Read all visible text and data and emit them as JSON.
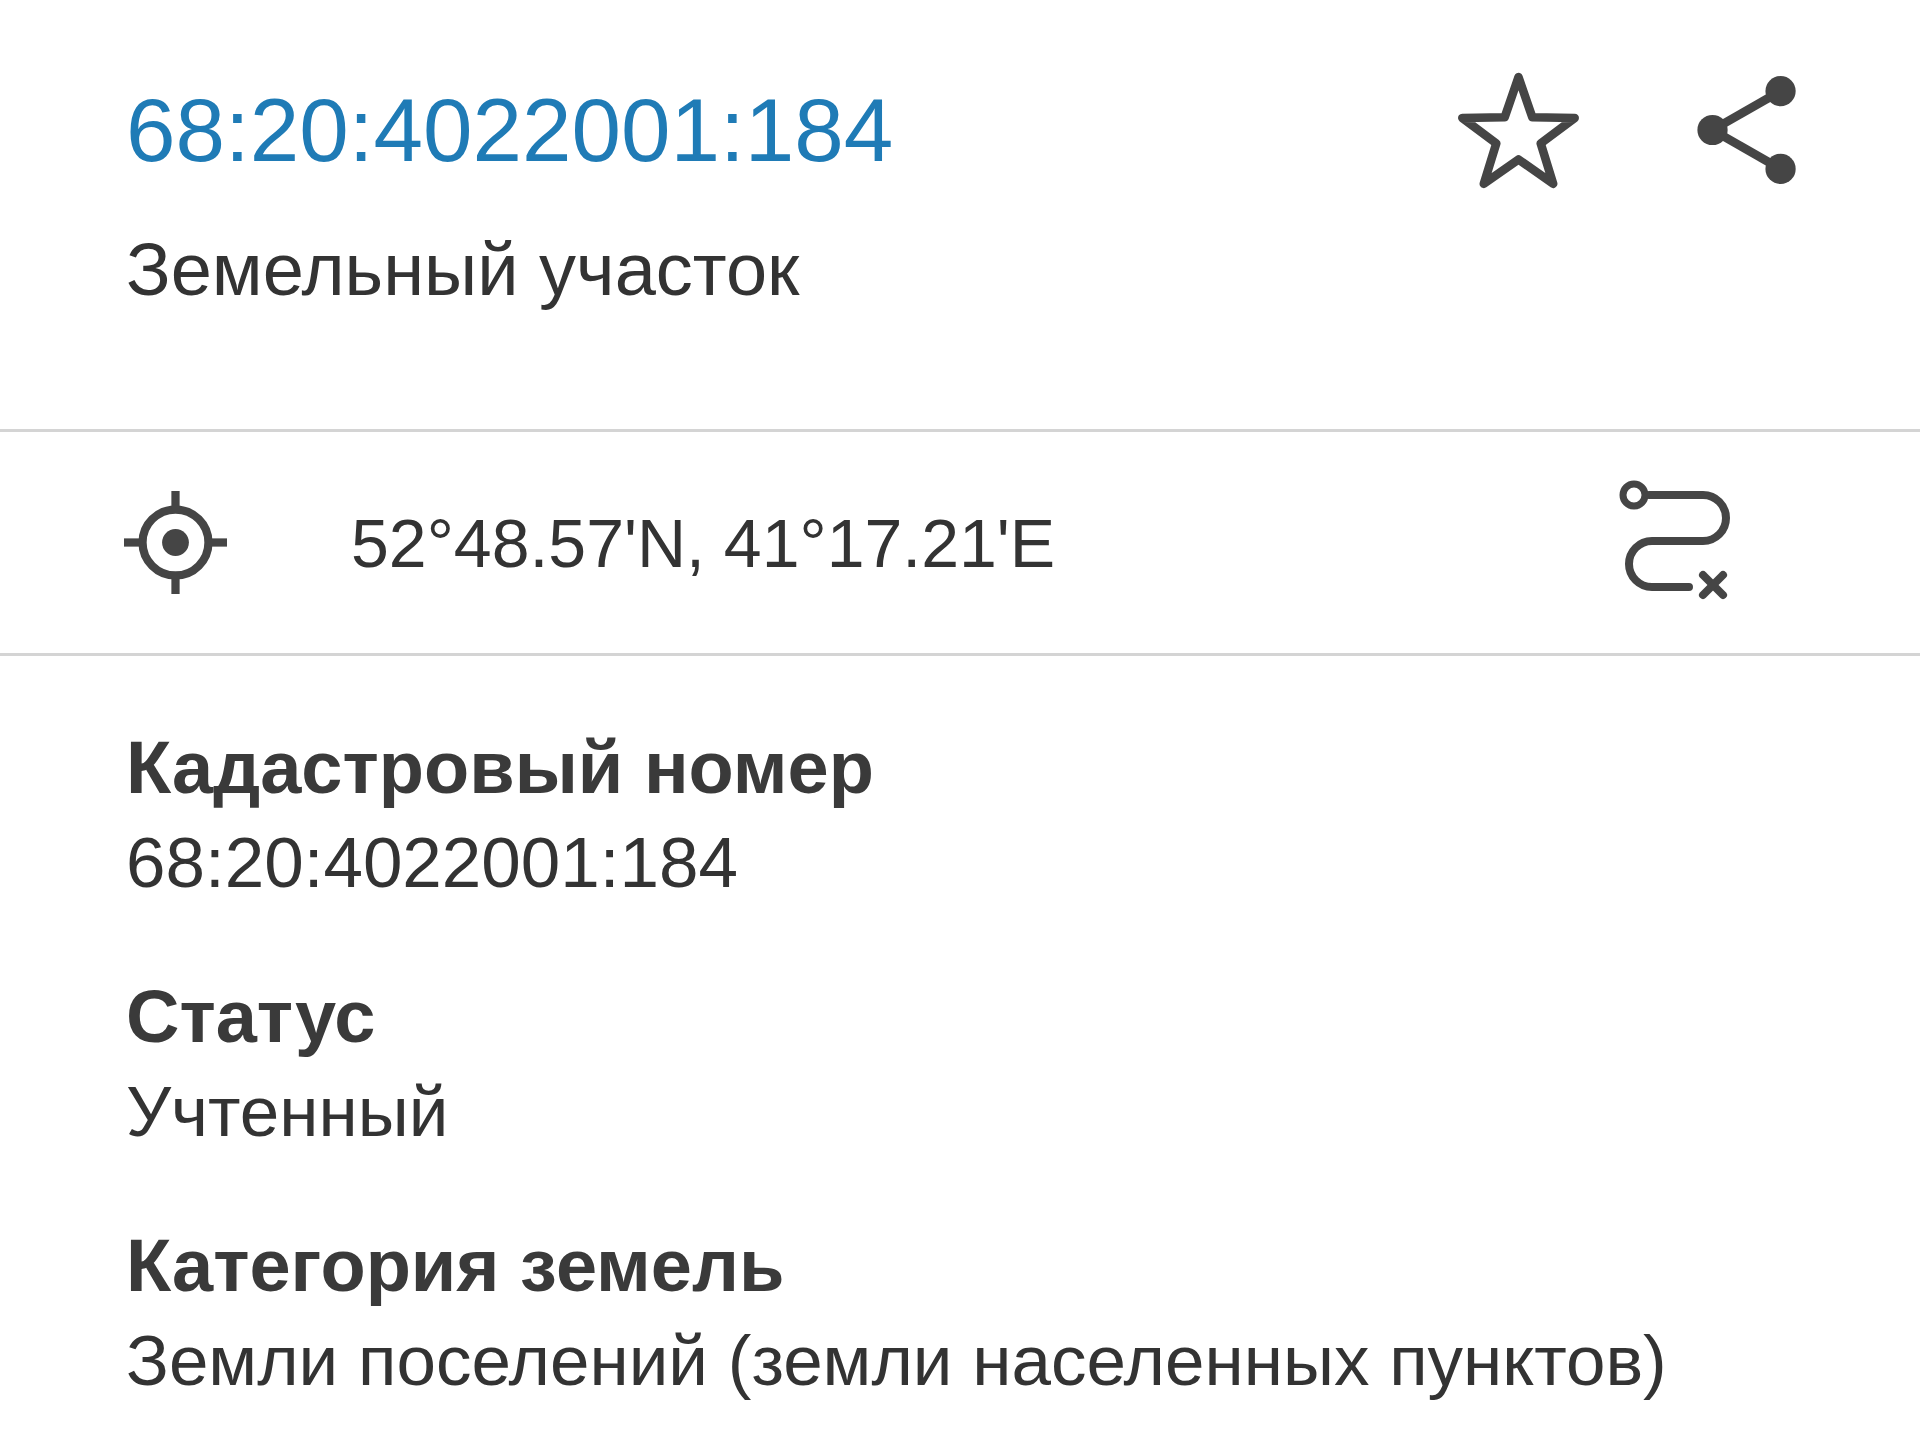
{
  "header": {
    "title": "68:20:4022001:184",
    "subtitle": "Земельный участок",
    "starred": false
  },
  "location": {
    "coordinates": "52°48.57'N, 41°17.21'E"
  },
  "fields": [
    {
      "label": "Кадастровый номер",
      "value": "68:20:4022001:184"
    },
    {
      "label": "Статус",
      "value": "Учтенный"
    },
    {
      "label": "Категория земель",
      "value": "Земли поселений (земли населенных пунктов)"
    }
  ]
}
